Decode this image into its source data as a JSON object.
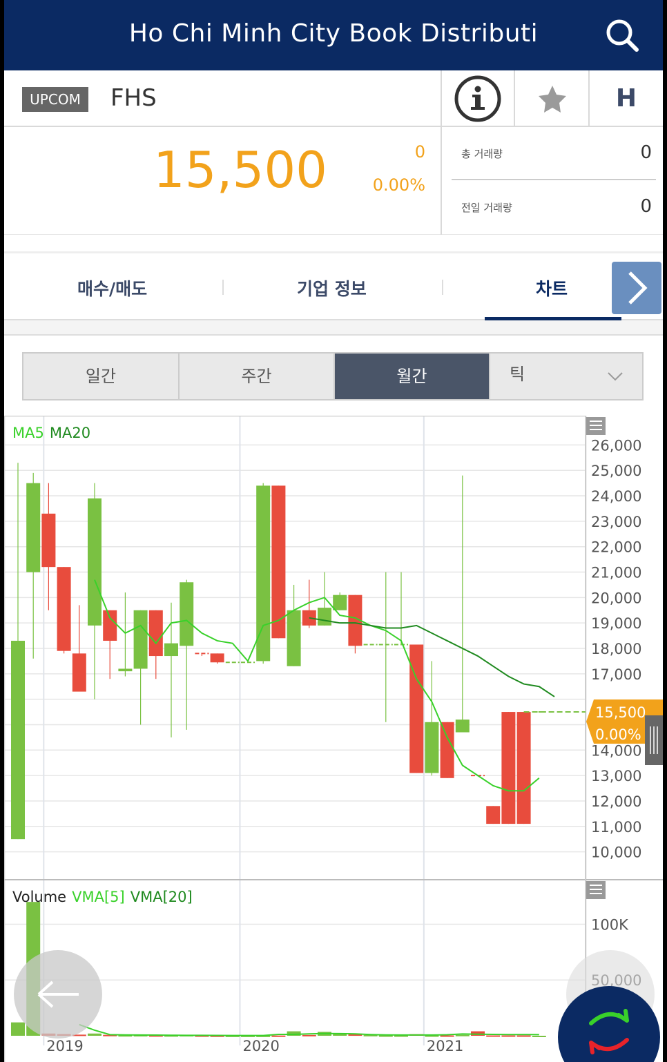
{
  "header": {
    "title": "Ho Chi Minh City Book Distributi",
    "search_icon": "search-icon"
  },
  "stock": {
    "market": "UPCOM",
    "symbol": "FHS",
    "price": "15,500",
    "change": "0",
    "change_pct": "0.00%",
    "total_volume_label": "총 거래량",
    "total_volume": "0",
    "prev_volume_label": "전일 거래량",
    "prev_volume": "0",
    "h_label": "H"
  },
  "tabs": [
    {
      "label": "매수/매도"
    },
    {
      "label": "기업 정보"
    },
    {
      "label": "차트",
      "active": true
    }
  ],
  "periods": [
    {
      "label": "일간"
    },
    {
      "label": "주간"
    },
    {
      "label": "월간",
      "active": true
    },
    {
      "label": "틱"
    }
  ],
  "colors": {
    "up": "#7ac142",
    "down": "#e84c3d",
    "accent": "#f2a21b",
    "header": "#0b2a63"
  },
  "chart_data": {
    "type": "candlestick",
    "legend": [
      "MA5",
      "MA20"
    ],
    "volume_legend": [
      "Volume",
      "VMA[5]",
      "VMA[20]"
    ],
    "x_labels": [
      "2019",
      "2020",
      "2021"
    ],
    "y_ticks": [
      "26,000",
      "25,000",
      "24,000",
      "23,000",
      "22,000",
      "21,000",
      "20,000",
      "19,000",
      "18,000",
      "17,000",
      "14,000",
      "13,000",
      "12,000",
      "11,000",
      "10,000"
    ],
    "volume_ticks": [
      "100K",
      "50,000"
    ],
    "ylim": [
      9500,
      26500
    ],
    "volume_ylim": [
      0,
      130000
    ],
    "current_price_label": "15,500",
    "current_change_label": "0.00%",
    "current_price": 15500,
    "candles": [
      {
        "o": 10500,
        "h": 25300,
        "l": 10500,
        "c": 18300
      },
      {
        "o": 21000,
        "h": 24900,
        "l": 17600,
        "c": 24500
      },
      {
        "o": 23300,
        "h": 24500,
        "l": 19500,
        "c": 21200
      },
      {
        "o": 21200,
        "h": 21200,
        "l": 17800,
        "c": 17900
      },
      {
        "o": 17800,
        "h": 19700,
        "l": 16500,
        "c": 16300
      },
      {
        "o": 18900,
        "h": 24500,
        "l": 16000,
        "c": 23900
      },
      {
        "o": 19500,
        "h": 19500,
        "l": 16800,
        "c": 18300
      },
      {
        "o": 17100,
        "h": 20200,
        "l": 16900,
        "c": 17200
      },
      {
        "o": 17200,
        "h": 19500,
        "l": 15000,
        "c": 19500
      },
      {
        "o": 19500,
        "h": 19500,
        "l": 16800,
        "c": 17700
      },
      {
        "o": 17700,
        "h": 19800,
        "l": 14500,
        "c": 18200
      },
      {
        "o": 18100,
        "h": 20700,
        "l": 14800,
        "c": 20600
      },
      {
        "o": 17800,
        "h": 17800,
        "l": 17700,
        "c": 17750
      },
      {
        "o": 17800,
        "h": 17800,
        "l": 17400,
        "c": 17450
      },
      {
        "o": 17450,
        "h": 17450,
        "l": 17450,
        "c": 17450
      },
      {
        "o": 17450,
        "h": 17450,
        "l": 17450,
        "c": 17450
      },
      {
        "o": 17500,
        "h": 24500,
        "l": 17400,
        "c": 24400
      },
      {
        "o": 24400,
        "h": 24400,
        "l": 18400,
        "c": 18400
      },
      {
        "o": 17300,
        "h": 20500,
        "l": 17300,
        "c": 19500
      },
      {
        "o": 19500,
        "h": 20700,
        "l": 18800,
        "c": 18900
      },
      {
        "o": 18900,
        "h": 21000,
        "l": 18900,
        "c": 19600
      },
      {
        "o": 19500,
        "h": 20200,
        "l": 19500,
        "c": 20100
      },
      {
        "o": 20100,
        "h": 20100,
        "l": 17800,
        "c": 18100
      },
      {
        "o": 18150,
        "h": 18150,
        "l": 18150,
        "c": 18150
      },
      {
        "o": 18150,
        "h": 21000,
        "l": 15100,
        "c": 18150
      },
      {
        "o": 18150,
        "h": 21000,
        "l": 18150,
        "c": 18150
      },
      {
        "o": 18150,
        "h": 18150,
        "l": 13100,
        "c": 13100
      },
      {
        "o": 13100,
        "h": 17500,
        "l": 13000,
        "c": 15100
      },
      {
        "o": 15100,
        "h": 15100,
        "l": 12900,
        "c": 12900
      },
      {
        "o": 14700,
        "h": 24800,
        "l": 14700,
        "c": 15200
      },
      {
        "o": 13000,
        "h": 13000,
        "l": 13000,
        "c": 12990
      },
      {
        "o": 11800,
        "h": 11800,
        "l": 11100,
        "c": 11100
      },
      {
        "o": 15500,
        "h": 15500,
        "l": 11100,
        "c": 11100
      },
      {
        "o": 15500,
        "h": 15500,
        "l": 11100,
        "c": 11100
      },
      {
        "o": 15500,
        "h": 15500,
        "l": 15500,
        "c": 15500
      }
    ],
    "ma5": [
      null,
      null,
      null,
      null,
      null,
      20700,
      19200,
      18600,
      18900,
      18200,
      19000,
      19100,
      18600,
      18300,
      18200,
      17500,
      18900,
      19100,
      19500,
      19800,
      20000,
      19300,
      19200,
      18900,
      18700,
      18300,
      16800,
      15900,
      14500,
      13400,
      13000,
      12600,
      12400,
      12400,
      12900
    ],
    "ma20": [
      null,
      null,
      null,
      null,
      null,
      null,
      null,
      null,
      null,
      null,
      null,
      null,
      null,
      null,
      null,
      null,
      null,
      null,
      null,
      19200,
      19100,
      19000,
      19000,
      18900,
      18800,
      18800,
      18900,
      18600,
      18300,
      18000,
      17700,
      17300,
      16900,
      16600,
      16500,
      16100
    ],
    "volume": [
      12000,
      120000,
      2000,
      1500,
      1000,
      2000,
      800,
      500,
      600,
      400,
      400,
      600,
      300,
      200,
      100,
      100,
      100,
      200,
      4000,
      700,
      3500,
      1600,
      1200,
      700,
      300,
      300,
      1400,
      300,
      300,
      800,
      4000,
      300,
      300,
      300,
      0
    ],
    "vma5": [
      null,
      null,
      null,
      null,
      10000,
      5000,
      1000,
      800,
      700,
      600,
      500,
      400,
      350,
      300,
      250,
      200,
      200,
      1200,
      1200,
      1700,
      2000,
      1900,
      1700,
      1100,
      800,
      700,
      700,
      700,
      900,
      1600,
      1400,
      1200,
      1100,
      1100,
      1000
    ]
  }
}
